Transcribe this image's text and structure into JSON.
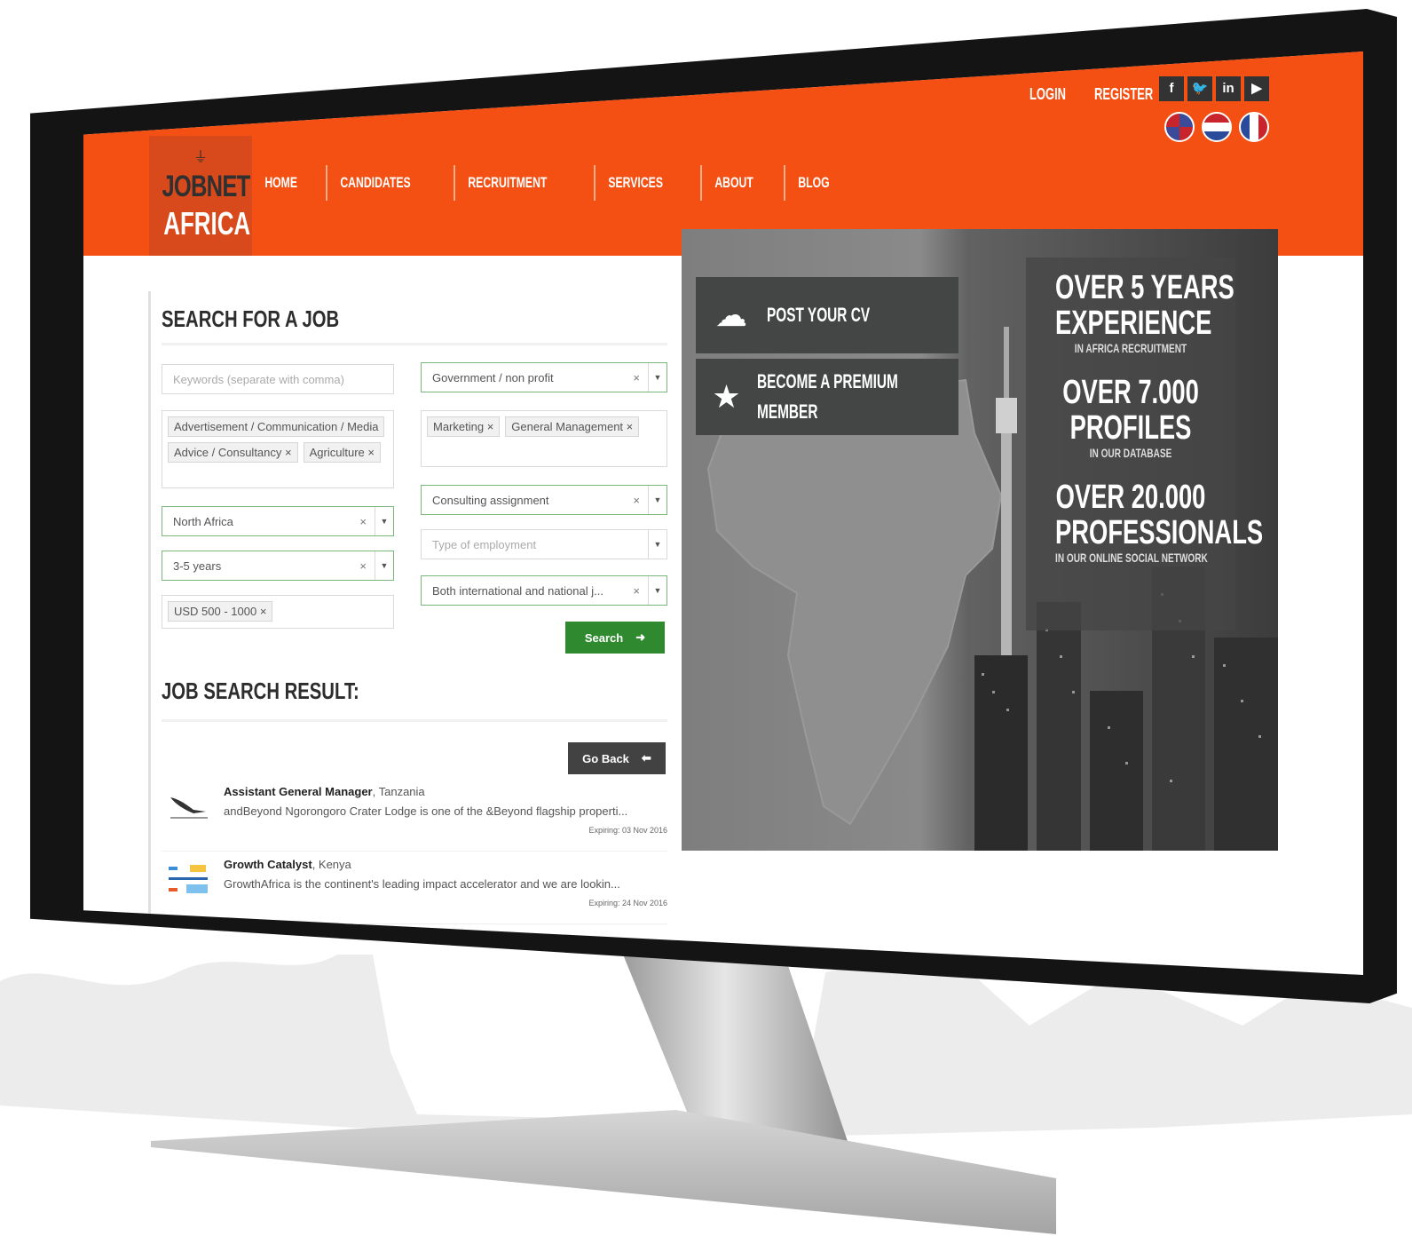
{
  "header": {
    "logo_line1": "JOBNET",
    "logo_line2": "AFRICA",
    "nav": [
      "HOME",
      "CANDIDATES",
      "RECRUITMENT",
      "SERVICES",
      "ABOUT",
      "BLOG"
    ],
    "login": "LOGIN",
    "register": "REGISTER",
    "social": [
      "f",
      "t",
      "in",
      "yt"
    ],
    "colors": {
      "accent": "#f55013",
      "logo_bg": "#d84a1c"
    }
  },
  "search": {
    "title": "SEARCH FOR A JOB",
    "keywords_placeholder": "Keywords (separate with comma)",
    "sector": "Government / non profit",
    "categories_left": [
      "Advertisement / Communication / Media",
      "Advice / Consultancy",
      "Agriculture"
    ],
    "categories_right": [
      "Marketing",
      "General Management"
    ],
    "region": "North Africa",
    "contract": "Consulting assignment",
    "employment_placeholder": "Type of employment",
    "experience": "3-5 years",
    "scope": "Both international and national j...",
    "salary": "USD 500 - 1000",
    "search_button": "Search",
    "tag_remove": "×"
  },
  "results": {
    "title": "JOB SEARCH RESULT:",
    "back_button": "Go Back",
    "jobs": [
      {
        "title": "Assistant General Manager",
        "location": ", Tanzania",
        "description": "andBeyond Ngorongoro Crater Lodge is one of the &Beyond flagship properti...",
        "expiry": "Expiring: 03 Nov 2016"
      },
      {
        "title": "Growth Catalyst",
        "location": ", Kenya",
        "description": "GrowthAfrica is the continent's leading impact accelerator and we are lookin...",
        "expiry": "Expiring: 24 Nov 2016"
      }
    ]
  },
  "hero": {
    "post_cv": "POST YOUR CV",
    "premium_line1": "BECOME A PREMIUM",
    "premium_line2": "MEMBER",
    "stats": [
      {
        "line1": "OVER 5 YEARS",
        "line2": "EXPERIENCE",
        "sub": "IN AFRICA RECRUITMENT"
      },
      {
        "line1": "OVER 7.000",
        "line2": "PROFILES",
        "sub": "IN OUR DATABASE"
      },
      {
        "line1": "OVER 20.000",
        "line2": "PROFESSIONALS",
        "sub": "IN OUR ONLINE SOCIAL NETWORK"
      }
    ]
  }
}
